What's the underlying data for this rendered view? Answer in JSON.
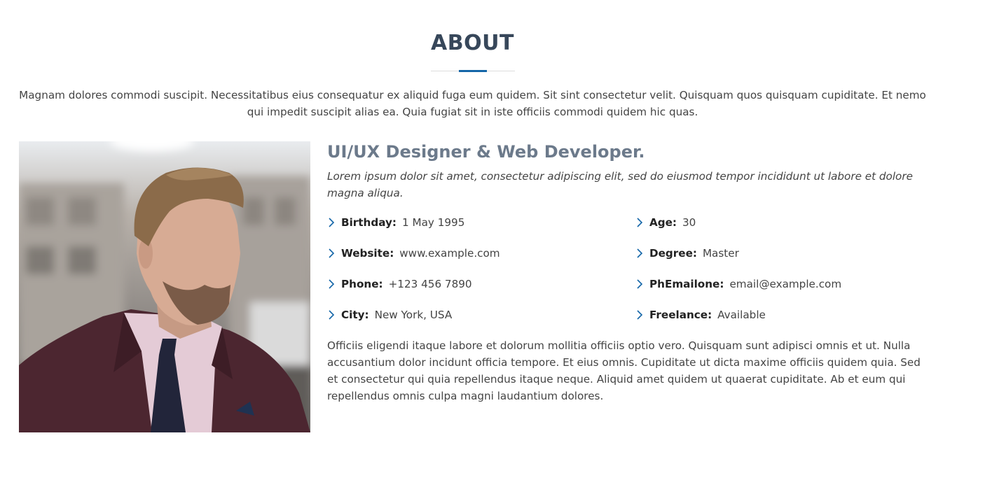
{
  "about": {
    "title": "ABOUT",
    "intro": "Magnam dolores commodi suscipit. Necessitatibus eius consequatur ex aliquid fuga eum quidem. Sit sint consectetur velit. Quisquam quos quisquam cupiditate. Et nemo qui impedit suscipit alias ea. Quia fugiat sit in iste officiis commodi quidem hic quas."
  },
  "profile": {
    "role": "UI/UX Designer & Web Developer.",
    "lead": "Lorem ipsum dolor sit amet, consectetur adipiscing elit, sed do eiusmod tempor incididunt ut labore et dolore magna aliqua.",
    "bio": "Officiis eligendi itaque labore et dolorum mollitia officiis optio vero. Quisquam sunt adipisci omnis et ut. Nulla accusantium dolor incidunt officia tempore. Et eius omnis. Cupiditate ut dicta maxime officiis quidem quia. Sed et consectetur qui quia repellendus itaque neque. Aliquid amet quidem ut quaerat cupiditate. Ab et eum qui repellendus omnis culpa magni laudantium dolores."
  },
  "facts_left": [
    {
      "label": "Birthday:",
      "value": "1 May 1995"
    },
    {
      "label": "Website:",
      "value": "www.example.com"
    },
    {
      "label": "Phone:",
      "value": "+123 456 7890"
    },
    {
      "label": "City:",
      "value": "New York, USA"
    }
  ],
  "facts_right": [
    {
      "label": "Age:",
      "value": "30"
    },
    {
      "label": "Degree:",
      "value": "Master"
    },
    {
      "label": "PhEmailone:",
      "value": "email@example.com"
    },
    {
      "label": "Freelance:",
      "value": "Available"
    }
  ],
  "icons": {
    "fact_bullet": "chevron-right-icon"
  },
  "colors": {
    "title": "#37475a",
    "accent": "#1466a8",
    "role": "#6c7a8b",
    "bullet": "#1466a8"
  }
}
